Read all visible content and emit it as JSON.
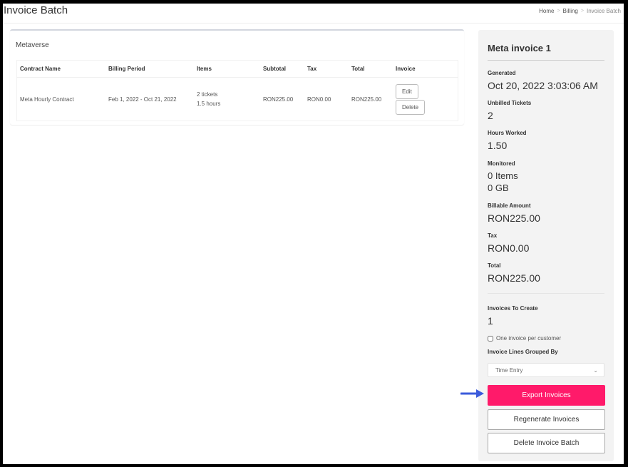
{
  "header": {
    "title": "Invoice Batch",
    "breadcrumb": [
      {
        "label": "Home"
      },
      {
        "label": "Billing"
      },
      {
        "label": "Invoice Batch"
      }
    ],
    "breadcrumb_separator": ">"
  },
  "batch": {
    "customer_name": "Metaverse",
    "table": {
      "columns": [
        "Contract Name",
        "Billing Period",
        "Items",
        "Subtotal",
        "Tax",
        "Total",
        "Invoice"
      ],
      "rows": [
        {
          "contract_name": "Meta Hourly Contract",
          "billing_period": "Feb 1, 2022 - Oct 21, 2022",
          "items": [
            "2 tickets",
            "1.5 hours"
          ],
          "subtotal": "RON225.00",
          "tax": "RON0.00",
          "total": "RON225.00",
          "actions": {
            "edit": "Edit",
            "delete": "Delete"
          }
        }
      ]
    }
  },
  "summary": {
    "title": "Meta invoice 1",
    "generated_label": "Generated",
    "generated_value": "Oct 20, 2022 3:03:06 AM",
    "unbilled_tickets_label": "Unbilled Tickets",
    "unbilled_tickets_value": "2",
    "hours_worked_label": "Hours Worked",
    "hours_worked_value": "1.50",
    "monitored_label": "Monitored",
    "monitored_items": "0 Items",
    "monitored_gb": "0 GB",
    "billable_amount_label": "Billable Amount",
    "billable_amount_value": "RON225.00",
    "tax_label": "Tax",
    "tax_value": "RON0.00",
    "total_label": "Total",
    "total_value": "RON225.00",
    "invoices_to_create_label": "Invoices To Create",
    "invoices_to_create_value": "1",
    "one_invoice_per_customer_label": "One invoice per customer",
    "one_invoice_per_customer_checked": false,
    "grouped_by_label": "Invoice Lines Grouped By",
    "grouped_by_value": "Time Entry",
    "buttons": {
      "export": "Export Invoices",
      "regenerate": "Regenerate Invoices",
      "delete_batch": "Delete Invoice Batch"
    }
  },
  "colors": {
    "primary": "#ff1a6a",
    "annotation_arrow": "#3b5bdb"
  }
}
